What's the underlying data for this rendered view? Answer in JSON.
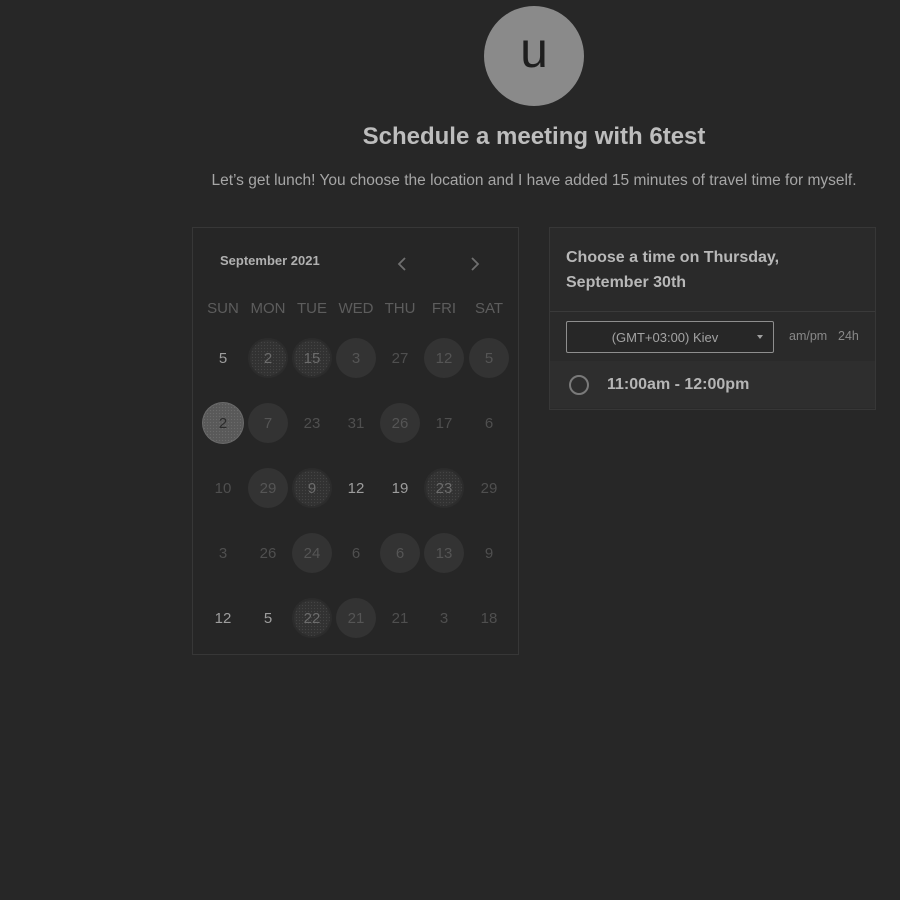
{
  "avatar": {
    "initial": "u"
  },
  "header": {
    "title": "Schedule a meeting with 6test",
    "subtitle": "Let’s get lunch! You choose the location and I have added 15 minutes of travel time for myself."
  },
  "calendar": {
    "month_label": "September 2021",
    "prev_icon": "chevron-left-icon",
    "next_icon": "chevron-right-icon",
    "weekdays": [
      "SUN",
      "MON",
      "TUE",
      "WED",
      "THU",
      "FRI",
      "SAT"
    ],
    "weeks": [
      [
        {
          "label": "5",
          "style": "bright"
        },
        {
          "label": "2",
          "style": "dotted"
        },
        {
          "label": "15",
          "style": "dotted"
        },
        {
          "label": "3",
          "style": "filled"
        },
        {
          "label": "27",
          "style": "muted"
        },
        {
          "label": "12",
          "style": "filled"
        },
        {
          "label": "5",
          "style": "filled"
        }
      ],
      [
        {
          "label": "2",
          "style": "selected"
        },
        {
          "label": "7",
          "style": "filled"
        },
        {
          "label": "23",
          "style": "muted"
        },
        {
          "label": "31",
          "style": "muted"
        },
        {
          "label": "26",
          "style": "filled"
        },
        {
          "label": "17",
          "style": "muted"
        },
        {
          "label": "6",
          "style": "muted"
        }
      ],
      [
        {
          "label": "10",
          "style": "muted"
        },
        {
          "label": "29",
          "style": "filled"
        },
        {
          "label": "9",
          "style": "dotted"
        },
        {
          "label": "12",
          "style": "bright"
        },
        {
          "label": "19",
          "style": "bright"
        },
        {
          "label": "23",
          "style": "dotted"
        },
        {
          "label": "29",
          "style": "muted"
        }
      ],
      [
        {
          "label": "3",
          "style": "muted"
        },
        {
          "label": "26",
          "style": "muted"
        },
        {
          "label": "24",
          "style": "filled"
        },
        {
          "label": "6",
          "style": "muted"
        },
        {
          "label": "6",
          "style": "filled"
        },
        {
          "label": "13",
          "style": "filled"
        },
        {
          "label": "9",
          "style": "muted"
        }
      ],
      [
        {
          "label": "12",
          "style": "bright"
        },
        {
          "label": "5",
          "style": "bright"
        },
        {
          "label": "22",
          "style": "dotted"
        },
        {
          "label": "21",
          "style": "filled"
        },
        {
          "label": "21",
          "style": "muted"
        },
        {
          "label": "3",
          "style": "muted"
        },
        {
          "label": "18",
          "style": "muted"
        }
      ]
    ]
  },
  "times": {
    "heading": "Choose a time on Thursday, September 30th",
    "timezone": "(GMT+03:00) Kiev",
    "format_ampm": "am/pm",
    "format_24h": "24h",
    "slots": [
      {
        "label": "11:00am - 12:00pm"
      }
    ]
  }
}
